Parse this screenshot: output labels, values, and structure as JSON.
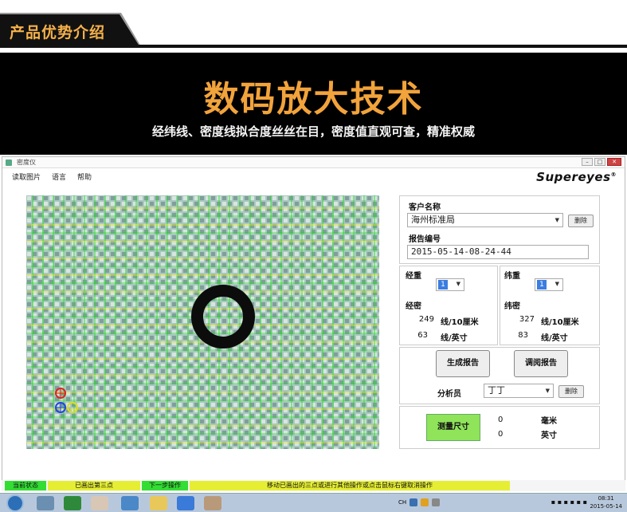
{
  "banner": {
    "section_title": "产品优势介绍",
    "headline": "数码放大技术",
    "subtitle": "经纬线、密度线拟合度丝丝在目，密度值直观可查，精准权威"
  },
  "window": {
    "title": "密度仪",
    "menu": [
      "读取图片",
      "语言",
      "帮助"
    ],
    "logo": "Supereyes",
    "logo_mark": "®"
  },
  "form": {
    "customer_label": "客户名称",
    "customer_value": "海州标准局",
    "delete_label": "删除",
    "report_no_label": "报告编号",
    "report_no_value": "2015-05-14-08-24-44",
    "warp_weight_label": "经重",
    "weft_weight_label": "纬重",
    "warp_weight_value": "1",
    "weft_weight_value": "1",
    "warp_density_label": "经密",
    "weft_density_label": "纬密",
    "warp_per_10cm": "249",
    "warp_per_inch": "63",
    "weft_per_10cm": "327",
    "weft_per_inch": "83",
    "unit_10cm": "线/10厘米",
    "unit_inch": "线/英寸",
    "generate_report": "生成报告",
    "view_report": "调阅报告",
    "analyst_label": "分析员",
    "analyst_value": "丁丁",
    "analyst_delete": "删除",
    "measure_button": "测量尺寸",
    "mm_value": "0",
    "inch_value": "0",
    "mm_unit": "毫米",
    "inch_unit": "英寸"
  },
  "status": {
    "current_state": "当前状态",
    "state_value": "已画出第三点",
    "next_step": "下一步操作",
    "next_value": "移动已画出的三点或进行其他操作或点击鼠标右键取消操作"
  },
  "taskbar": {
    "time": "08:31",
    "date": "2015-05-14",
    "lang": "CH"
  },
  "colors": {
    "banner_accent": "#f2a33b",
    "measure_green": "#8fe45a",
    "status_green": "#33dd33",
    "status_yellow": "#e6ee33"
  }
}
